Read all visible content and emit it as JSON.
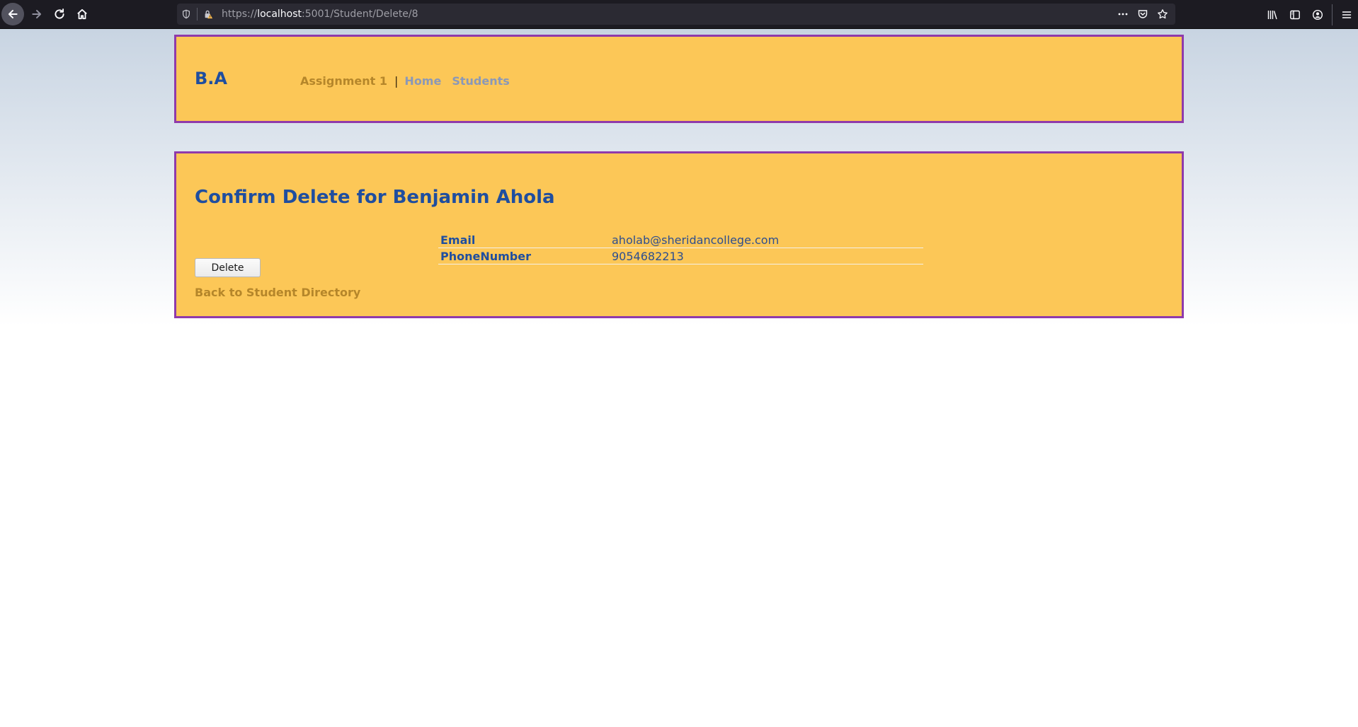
{
  "browser": {
    "url_scheme": "https://",
    "url_host": "localhost",
    "url_path": ":5001/Student/Delete/8"
  },
  "site": {
    "brand": "B.A",
    "app_name": "Assignment 1",
    "separator": "|",
    "nav_items": [
      "Home",
      "Students"
    ]
  },
  "main": {
    "title": "Confirm Delete for Benjamin Ahola",
    "fields": [
      {
        "label": "Email",
        "value": "aholab@sheridancollege.com"
      },
      {
        "label": "PhoneNumber",
        "value": "9054682213"
      }
    ],
    "delete_label": "Delete",
    "back_link": "Back to Student Directory"
  },
  "colors": {
    "panel_bg": "#fcc757",
    "panel_border": "#8f3aab",
    "heading": "#1f4e9f",
    "link_gold": "#b5862a",
    "nav_link": "#8a98b8"
  },
  "icons": [
    "back-arrow-icon",
    "forward-arrow-icon",
    "reload-icon",
    "home-icon",
    "shield-icon",
    "insecure-lock-icon",
    "more-dots-icon",
    "pocket-icon",
    "bookmark-star-icon",
    "library-icon",
    "sidebar-icon",
    "account-icon",
    "menu-icon"
  ]
}
